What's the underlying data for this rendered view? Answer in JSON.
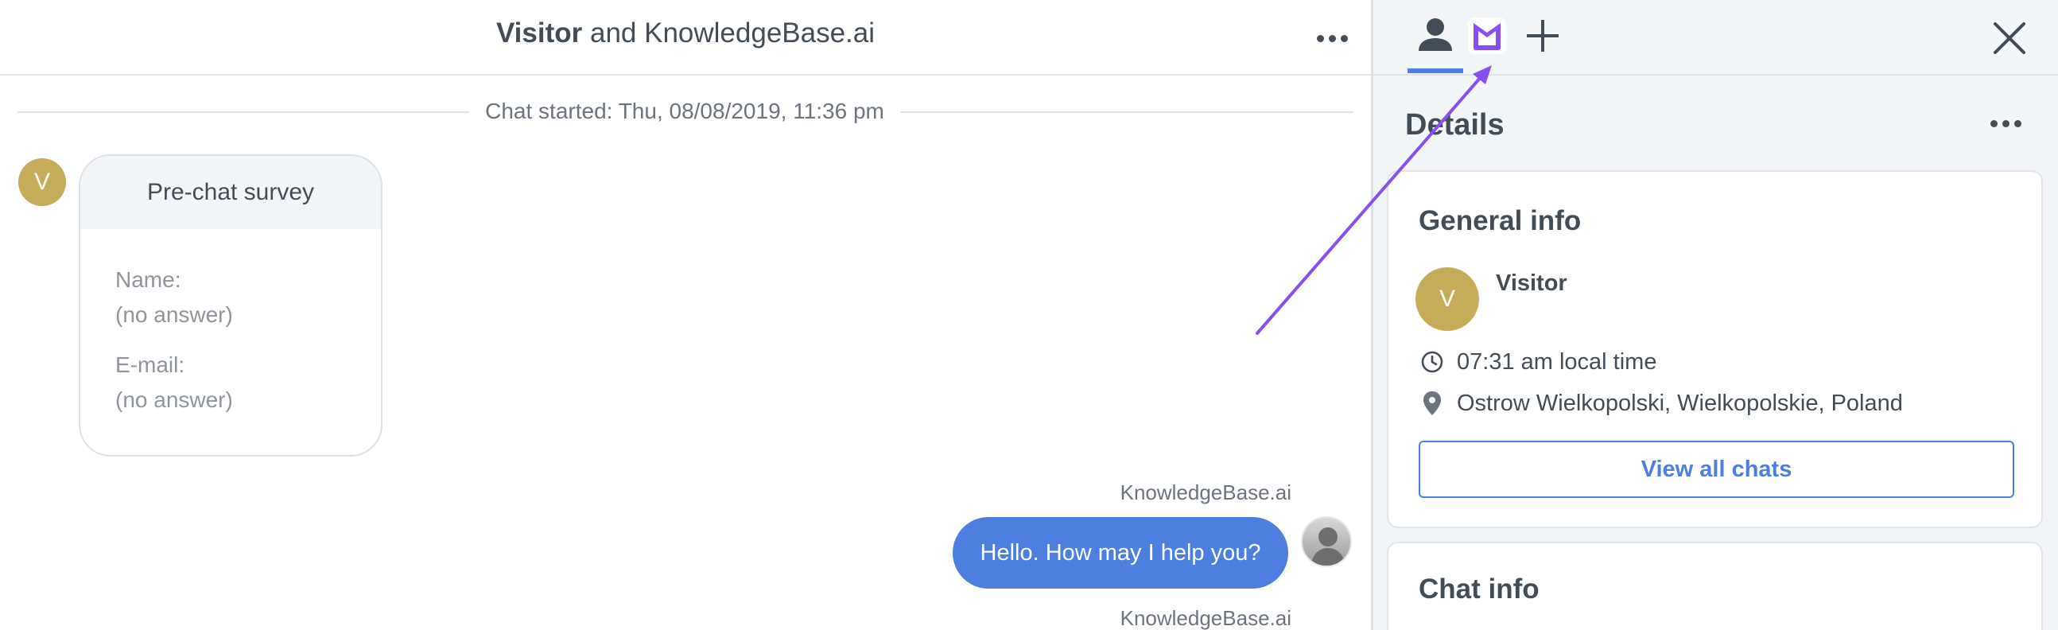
{
  "chat_header": {
    "title_bold": "Visitor",
    "title_rest": " and KnowledgeBase.ai"
  },
  "chat": {
    "started": "Chat started: Thu, 08/08/2019, 11:36 pm",
    "visitor_initial": "V",
    "survey": {
      "title": "Pre-chat survey",
      "fields": [
        {
          "label": "Name:",
          "value": "(no answer)"
        },
        {
          "label": "E-mail:",
          "value": "(no answer)"
        }
      ]
    },
    "messages": [
      {
        "author": "KnowledgeBase.ai",
        "text": "Hello. How may I help you?"
      },
      {
        "author": "KnowledgeBase.ai",
        "text": ""
      }
    ]
  },
  "side_panel": {
    "tabs": [
      {
        "icon": "person-icon",
        "active": true
      },
      {
        "icon": "knowledgebase-icon",
        "active": false
      },
      {
        "icon": "plus-icon",
        "active": false
      }
    ],
    "details_title": "Details",
    "general_info": {
      "title": "General info",
      "visitor_initial": "V",
      "visitor_name": "Visitor",
      "local_time": "07:31 am local time",
      "location": "Ostrow Wielkopolski, Wielkopolskie, Poland",
      "view_all_label": "View all chats"
    },
    "chat_info": {
      "title": "Chat info"
    }
  },
  "colors": {
    "accent": "#4d7fe0",
    "avatar": "#c6ab59",
    "kb_icon": "#8b4ef2",
    "annotation_arrow": "#8b4ef2"
  }
}
